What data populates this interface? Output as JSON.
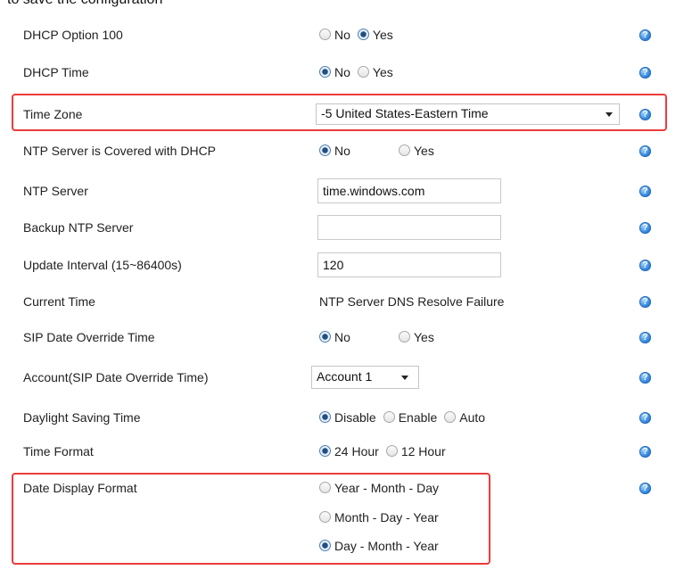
{
  "header_fragment": "to save the configuration",
  "rows": {
    "dhcp_option_100": {
      "label": "DHCP Option 100",
      "options": [
        "No",
        "Yes"
      ],
      "selected": "Yes"
    },
    "dhcp_time": {
      "label": "DHCP Time",
      "options": [
        "No",
        "Yes"
      ],
      "selected": "No"
    },
    "time_zone": {
      "label": "Time Zone",
      "value": "-5 United States-Eastern Time"
    },
    "ntp_dhcp": {
      "label": "NTP Server is Covered with DHCP",
      "options": [
        "No",
        "Yes"
      ],
      "selected": "No"
    },
    "ntp_server": {
      "label": "NTP Server",
      "value": "time.windows.com"
    },
    "backup_ntp": {
      "label": "Backup NTP Server",
      "value": ""
    },
    "update_interval": {
      "label": "Update Interval (15~86400s)",
      "value": "120"
    },
    "current_time": {
      "label": "Current Time",
      "value": "NTP Server DNS Resolve Failure"
    },
    "sip_date_override": {
      "label": "SIP Date Override Time",
      "options": [
        "No",
        "Yes"
      ],
      "selected": "No"
    },
    "account": {
      "label": "Account(SIP Date Override Time)",
      "value": "Account 1"
    },
    "daylight_saving": {
      "label": "Daylight Saving Time",
      "options": [
        "Disable",
        "Enable",
        "Auto"
      ],
      "selected": "Disable"
    },
    "time_format": {
      "label": "Time Format",
      "options": [
        "24 Hour",
        "12 Hour"
      ],
      "selected": "24 Hour"
    },
    "date_display_format": {
      "label": "Date Display Format",
      "options": [
        "Year - Month - Day",
        "Month - Day - Year",
        "Day - Month - Year"
      ],
      "selected": "Day - Month - Year"
    }
  },
  "colors": {
    "highlight": "#ec3b3b",
    "help_icon": "#1e78d6",
    "radio_checked": "#1f4f86"
  },
  "icons": {
    "help": "help-icon"
  }
}
